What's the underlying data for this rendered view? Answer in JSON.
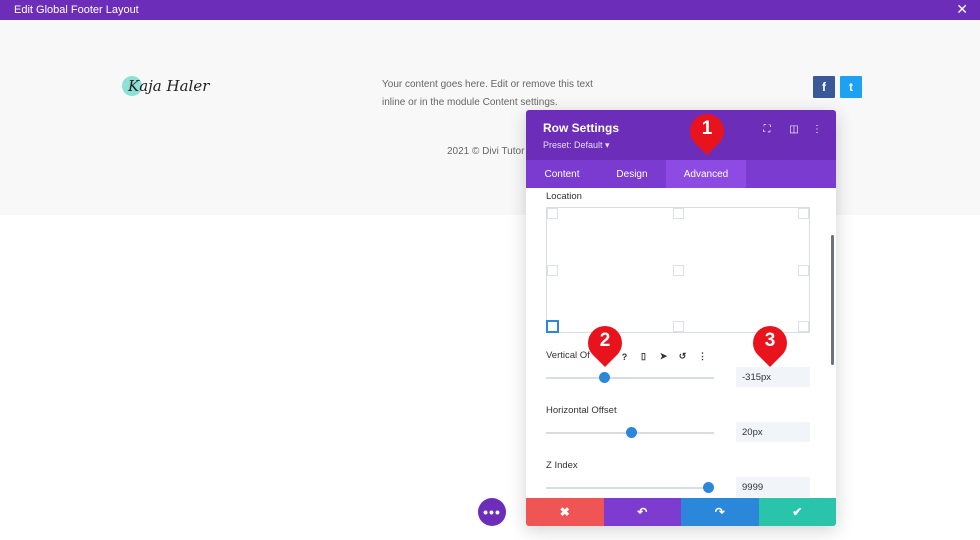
{
  "topbar": {
    "title": "Edit Global Footer Layout",
    "close_glyph": "✕"
  },
  "page": {
    "logo_text": "Kaja Haler",
    "content_text": "Your content goes here. Edit or remove this text inline or in the module Content settings.",
    "copyright": "2021 © Divi Tutor",
    "facebook_glyph": "f",
    "twitter_glyph": "t"
  },
  "panel": {
    "title": "Row Settings",
    "preset": "Preset: Default ▾",
    "header_icons": {
      "fullscreen": "⛶",
      "columns": "◫",
      "more": "⋮"
    },
    "tabs": [
      {
        "label": "Content"
      },
      {
        "label": "Design"
      },
      {
        "label": "Advanced"
      }
    ],
    "active_tab": "Advanced",
    "location_label": "Location",
    "vertical_offset": {
      "label": "Vertical Of",
      "value": "-315px",
      "fraction": 0.35
    },
    "horizontal_offset": {
      "label": "Horizontal Offset",
      "value": "20px",
      "fraction": 0.51
    },
    "z_index": {
      "label": "Z Index",
      "value": "9999",
      "fraction": 0.97
    },
    "toolbar_icons": {
      "help": "?",
      "mobile": "▯",
      "pointer": "➤",
      "reset": "↺",
      "more": "⋮"
    },
    "footer_buttons": {
      "cancel": "✖",
      "undo": "↶",
      "redo": "↷",
      "save": "✔"
    }
  },
  "markers": {
    "m1": "1",
    "m2": "2",
    "m3": "3"
  },
  "fab_glyph": "•••",
  "colors": {
    "purple": "#6c2eb9",
    "blue": "#2b87da",
    "red": "#ef5555",
    "green": "#29c4a9",
    "marker": "#e8131c"
  }
}
